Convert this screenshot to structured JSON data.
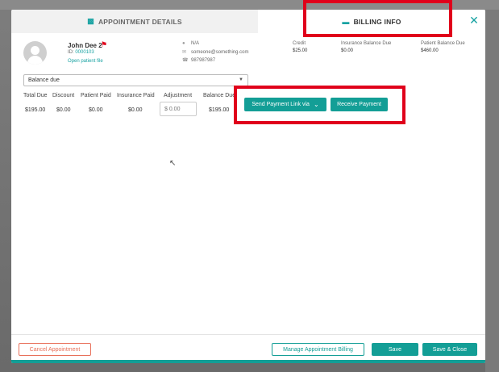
{
  "tabs": {
    "appointment_details": "APPOINTMENT DETAILS",
    "billing_info": "BILLING INFO"
  },
  "patient": {
    "name": "John Dee 2",
    "id_label": "ID:",
    "id_value": "0000103",
    "open_file": "Open patient file"
  },
  "contact": {
    "address": "N/A",
    "email": "someone@something.com",
    "phone": "987987987"
  },
  "balances": {
    "credit_label": "Credit",
    "credit_value": "$25.00",
    "insurance_label": "Insurance Balance Due",
    "insurance_value": "$0.00",
    "patient_label": "Patient Balance Due",
    "patient_value": "$460.00"
  },
  "filter": {
    "selected": "Balance due"
  },
  "table": {
    "headers": [
      "Total Due",
      "Discount",
      "Patient Paid",
      "Insurance Paid",
      "Adjustment",
      "Balance Due"
    ],
    "row": {
      "total_due": "$195.00",
      "discount": "$0.00",
      "patient_paid": "$0.00",
      "insurance_paid": "$0.00",
      "adjustment_placeholder": "$ 0.00",
      "balance_due": "$195.00"
    }
  },
  "actions": {
    "send_link": "Send Payment Link via",
    "receive_payment": "Receive Payment"
  },
  "footer": {
    "cancel": "Cancel Appointment",
    "manage": "Manage Appointment Billing",
    "save": "Save",
    "save_close": "Save & Close"
  },
  "colors": {
    "accent": "#139e96",
    "highlight": "#e0001b",
    "cancel": "#e8705a"
  },
  "icons": {
    "appointment_tab": "calendar-icon",
    "billing_tab": "card-icon",
    "close": "close-icon",
    "flag": "flag-icon",
    "address": "location-icon",
    "email": "mail-icon",
    "phone": "phone-icon",
    "dropdown": "caret-down-icon",
    "send_link_dropdown": "chevron-down-icon"
  }
}
